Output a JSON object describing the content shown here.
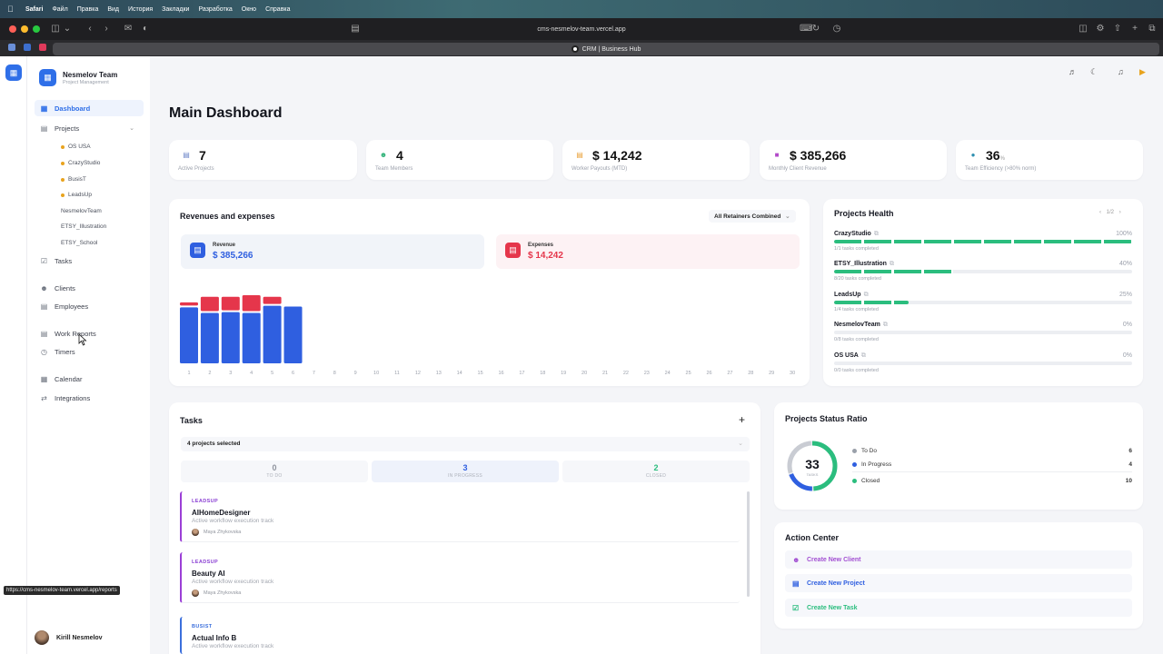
{
  "menubar": {
    "app": "Safari",
    "items": [
      "Файл",
      "Правка",
      "Вид",
      "История",
      "Закладки",
      "Разработка",
      "Окно",
      "Справка"
    ]
  },
  "browser": {
    "url": "cms-nesmelov-team.vercel.app",
    "tab_title": "CRM | Business Hub",
    "status_url": "https://cms-nesmelov-team.vercel.app/reports"
  },
  "brand": {
    "name": "Nesmelov Team",
    "subtitle": "Project Management"
  },
  "sidebar": {
    "dashboard": "Dashboard",
    "projects": "Projects",
    "project_items": [
      "OS USA",
      "CrazyStudio",
      "BusisT",
      "LeadsUp",
      "NesmelovTeam",
      "ETSY_Illustration",
      "ETSY_School"
    ],
    "tasks": "Tasks",
    "clients": "Clients",
    "employees": "Employees",
    "work_reports": "Work Reports",
    "timers": "Timers",
    "calendar": "Calendar",
    "integrations": "Integrations",
    "user_name": "Kirill Nesmelov"
  },
  "page_title": "Main Dashboard",
  "stats": [
    {
      "value": "7",
      "unit": "",
      "label": "Active Projects",
      "icon": "folder-icon",
      "color": "#6d86c9"
    },
    {
      "value": "4",
      "unit": "",
      "label": "Team Members",
      "icon": "users-icon",
      "color": "#32b37a"
    },
    {
      "value": "$ 14,242",
      "unit": "",
      "label": "Worker Payouts (MTD)",
      "icon": "wallet-icon",
      "color": "#e9a23b"
    },
    {
      "value": "$ 385,266",
      "unit": "",
      "label": "Monthly Client Revenue",
      "icon": "dollar-icon",
      "color": "#b24ac9"
    },
    {
      "value": "36",
      "unit": "%",
      "label": "Team Efficiency (>80% norm)",
      "icon": "bulb-icon",
      "color": "#2e8fb0"
    }
  ],
  "revenues": {
    "title": "Revenues and expenses",
    "filter": "All Retainers Combined",
    "revenue_label": "Revenue",
    "revenue_value": "$ 385,266",
    "expenses_label": "Expenses",
    "expenses_value": "$ 14,242"
  },
  "chart_data": {
    "type": "bar",
    "stacked": true,
    "categories": [
      "1",
      "2",
      "3",
      "4",
      "5",
      "6",
      "7",
      "8",
      "9",
      "10",
      "11",
      "12",
      "13",
      "14",
      "15",
      "16",
      "17",
      "18",
      "19",
      "20",
      "21",
      "22",
      "23",
      "24",
      "25",
      "26",
      "27",
      "28",
      "29",
      "30"
    ],
    "series": [
      {
        "name": "Revenue",
        "color": "#2f5fe0",
        "values": [
          70,
          63,
          64,
          63,
          72,
          71,
          0,
          0,
          0,
          0,
          0,
          0,
          0,
          0,
          0,
          0,
          0,
          0,
          0,
          0,
          0,
          0,
          0,
          0,
          0,
          0,
          0,
          0,
          0,
          0
        ]
      },
      {
        "name": "Expenses",
        "color": "#e5364b",
        "values": [
          4,
          18,
          17,
          20,
          9,
          0,
          0,
          0,
          0,
          0,
          0,
          0,
          0,
          0,
          0,
          0,
          0,
          0,
          0,
          0,
          0,
          0,
          0,
          0,
          0,
          0,
          0,
          0,
          0,
          0
        ]
      }
    ],
    "ylim": [
      0,
      100
    ],
    "grid": false
  },
  "health": {
    "title": "Projects Health",
    "pager": "1/2",
    "rows": [
      {
        "name": "CrazyStudio",
        "pct_label": "100%",
        "pct": 100,
        "sub": "1/1 tasks completed"
      },
      {
        "name": "ETSY_Illustration",
        "pct_label": "40%",
        "pct": 40,
        "sub": "8/20 tasks completed"
      },
      {
        "name": "LeadsUp",
        "pct_label": "25%",
        "pct": 25,
        "sub": "1/4 tasks completed"
      },
      {
        "name": "NesmelovTeam",
        "pct_label": "0%",
        "pct": 0,
        "sub": "0/8 tasks completed"
      },
      {
        "name": "OS USA",
        "pct_label": "0%",
        "pct": 0,
        "sub": "0/0 tasks completed"
      }
    ]
  },
  "tasks": {
    "title": "Tasks",
    "add": "+",
    "filter": "4 projects selected",
    "segments": [
      {
        "count": "0",
        "label": "TO DO",
        "color": "#8f949e"
      },
      {
        "count": "3",
        "label": "IN PROGRESS",
        "color": "#2f5fe0"
      },
      {
        "count": "2",
        "label": "CLOSED",
        "color": "#2bbd7e"
      }
    ],
    "items": [
      {
        "project": "LEADSUP",
        "title": "AIHomeDesigner",
        "desc": "Active workflow execution track",
        "assignee": "Maya Zhykovska",
        "color": "#9b3fd6"
      },
      {
        "project": "LEADSUP",
        "title": "Beauty AI",
        "desc": "Active workflow execution track",
        "assignee": "Maya Zhykovska",
        "color": "#9b3fd6"
      },
      {
        "project": "BUSIST",
        "title": "Actual Info B",
        "desc": "Active workflow execution track",
        "assignee": "",
        "color": "#3b6fdc"
      }
    ]
  },
  "status_ratio": {
    "title": "Projects Status Ratio",
    "total": "33",
    "total_label": "TASKS",
    "rows": [
      {
        "label": "To Do",
        "value": "6",
        "color": "#9aa0aa"
      },
      {
        "label": "In Progress",
        "value": "4",
        "color": "#2f5fe0"
      },
      {
        "label": "Closed",
        "value": "10",
        "color": "#2bbd7e"
      }
    ]
  },
  "actions": {
    "title": "Action Center",
    "items": [
      {
        "label": "Create New Client",
        "color": "#a24fd2",
        "icon": "user-plus-icon"
      },
      {
        "label": "Create New Project",
        "color": "#2f5fe0",
        "icon": "folder-plus-icon"
      },
      {
        "label": "Create New Task",
        "color": "#2bbd7e",
        "icon": "check-square-icon"
      }
    ]
  }
}
